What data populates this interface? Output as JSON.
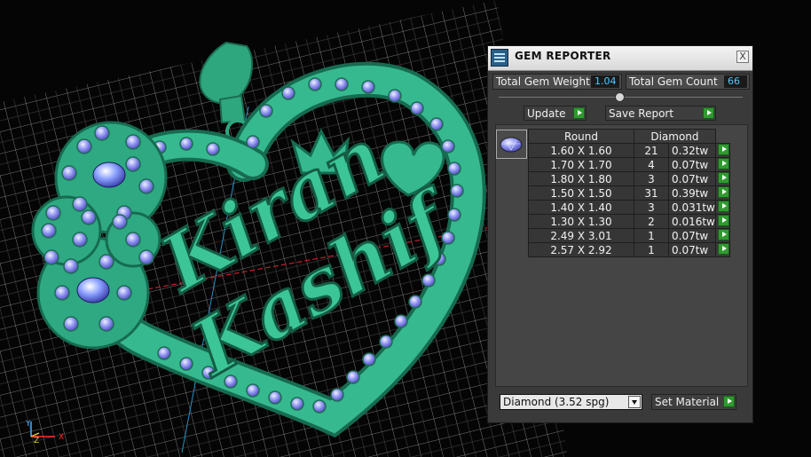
{
  "window": {
    "title": "GEM REPORTER",
    "close_label": "X"
  },
  "stats": {
    "weight_label": "Total Gem Weight",
    "weight_value": "1.04",
    "count_label": "Total Gem Count",
    "count_value": "66"
  },
  "buttons": {
    "update": "Update",
    "save_report": "Save Report",
    "set_material": "Set Material"
  },
  "table": {
    "headers": [
      "Round",
      "Diamond"
    ],
    "rows": [
      {
        "size": "1.60 X 1.60",
        "count": "21",
        "weight": "0.32tw"
      },
      {
        "size": "1.70 X 1.70",
        "count": "4",
        "weight": "0.07tw"
      },
      {
        "size": "1.80 X 1.80",
        "count": "3",
        "weight": "0.07tw"
      },
      {
        "size": "1.50 X 1.50",
        "count": "31",
        "weight": "0.39tw"
      },
      {
        "size": "1.40 X 1.40",
        "count": "3",
        "weight": "0.031tw"
      },
      {
        "size": "1.30 X 1.30",
        "count": "2",
        "weight": "0.016tw"
      },
      {
        "size": "2.49 X 3.01",
        "count": "1",
        "weight": "0.07tw"
      },
      {
        "size": "2.57 X 2.92",
        "count": "1",
        "weight": "0.07tw"
      }
    ]
  },
  "material": {
    "selected": "Diamond    (3.52 spg)"
  },
  "viewport": {
    "pendant_text_top": "Kiran",
    "pendant_text_bottom": "Kashif",
    "axis_labels": [
      "Y",
      "Z",
      "X"
    ]
  },
  "colors": {
    "metal": "#36b98e",
    "gem": "#8d90f0",
    "accent_value": "#4fc8ff",
    "play_button": "#2f9a2f"
  },
  "icons": {
    "title": "gem-reporter-icon",
    "close": "close-icon",
    "action": "play-arrow-icon",
    "dropdown": "chevron-down-icon",
    "thumb": "round-gem-icon"
  }
}
